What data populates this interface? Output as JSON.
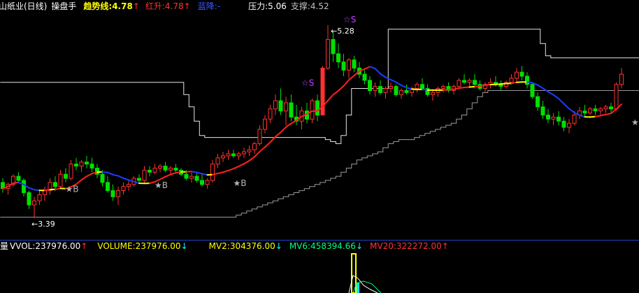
{
  "header": {
    "stock_name": "青山纸业(日线)",
    "indicator": "操盘手",
    "trend": "趋势线:4.78",
    "trend_arrow": "↑",
    "red_rise": "红升:4.78",
    "red_arrow": "↑",
    "blue_fall": "蓝降:-",
    "pressure": "压力:5.06",
    "support": "支撑:4.52"
  },
  "volume_header": {
    "title": "成交量",
    "vvol": "VVOL:237976.00",
    "vvol_arrow": "↑",
    "volume": "VOLUME:237976.00",
    "volume_arrow": "↓",
    "mv2": "MV2:304376.00",
    "mv2_arrow": "↓",
    "mv6": "MV6:458394.66",
    "mv6_arrow": "↓",
    "mv20": "MV20:322272.00",
    "mv20_arrow": "↑"
  },
  "colors": {
    "background": "#000000",
    "up_candle": "#ff3232",
    "down_candle": "#00e000",
    "trend_up": "#ff2020",
    "trend_down": "#1e3cff",
    "trend_flat": "#ffff00",
    "band": "#c8c8c8",
    "header_yellow": "#ffff00",
    "header_red": "#ff3232",
    "header_blue": "#3c5aff",
    "header_white": "#ffffff",
    "header_gray": "#c0c0c0",
    "mv2_green": "#00ff00",
    "mv6_green": "#00ff80",
    "signal_purple": "#c040ff",
    "signal_gray": "#b4b4b4",
    "divider": "#2040c0"
  },
  "chart_data": {
    "type": "candlestick",
    "annotations": [
      {
        "label": "5.28",
        "kind": "high"
      },
      {
        "label": "3.39",
        "kind": "low"
      },
      {
        "label": "B",
        "kind": "buy"
      },
      {
        "label": "B",
        "kind": "buy"
      },
      {
        "label": "B",
        "kind": "buy"
      },
      {
        "label": "S",
        "kind": "sell"
      },
      {
        "label": "S",
        "kind": "sell"
      }
    ],
    "ohlc": [
      [
        3.74,
        3.78,
        3.64,
        3.68
      ],
      [
        3.68,
        3.74,
        3.62,
        3.72
      ],
      [
        3.72,
        3.82,
        3.7,
        3.8
      ],
      [
        3.8,
        3.84,
        3.74,
        3.76
      ],
      [
        3.76,
        3.78,
        3.6,
        3.64
      ],
      [
        3.64,
        3.66,
        3.48,
        3.52
      ],
      [
        3.52,
        3.6,
        3.39,
        3.56
      ],
      [
        3.56,
        3.66,
        3.52,
        3.62
      ],
      [
        3.62,
        3.7,
        3.56,
        3.66
      ],
      [
        3.66,
        3.78,
        3.62,
        3.74
      ],
      [
        3.74,
        3.8,
        3.66,
        3.7
      ],
      [
        3.7,
        3.86,
        3.68,
        3.82
      ],
      [
        3.82,
        3.88,
        3.74,
        3.78
      ],
      [
        3.78,
        3.96,
        3.76,
        3.92
      ],
      [
        3.92,
        3.98,
        3.86,
        3.9
      ],
      [
        3.9,
        3.96,
        3.84,
        3.94
      ],
      [
        3.94,
        4.0,
        3.88,
        3.92
      ],
      [
        3.92,
        3.98,
        3.84,
        3.88
      ],
      [
        3.88,
        3.92,
        3.78,
        3.82
      ],
      [
        3.82,
        3.86,
        3.7,
        3.74
      ],
      [
        3.74,
        3.8,
        3.64,
        3.66
      ],
      [
        3.66,
        3.72,
        3.56,
        3.6
      ],
      [
        3.6,
        3.7,
        3.52,
        3.66
      ],
      [
        3.66,
        3.74,
        3.62,
        3.7
      ],
      [
        3.7,
        3.76,
        3.66,
        3.72
      ],
      [
        3.72,
        3.8,
        3.7,
        3.78
      ],
      [
        3.78,
        3.82,
        3.74,
        3.76
      ],
      [
        3.76,
        3.9,
        3.74,
        3.86
      ],
      [
        3.86,
        3.9,
        3.8,
        3.84
      ],
      [
        3.84,
        3.92,
        3.82,
        3.88
      ],
      [
        3.88,
        3.92,
        3.84,
        3.9
      ],
      [
        3.9,
        3.94,
        3.84,
        3.86
      ],
      [
        3.86,
        3.9,
        3.82,
        3.88
      ],
      [
        3.88,
        3.92,
        3.84,
        3.86
      ],
      [
        3.86,
        3.88,
        3.8,
        3.82
      ],
      [
        3.82,
        3.86,
        3.76,
        3.78
      ],
      [
        3.78,
        3.84,
        3.74,
        3.8
      ],
      [
        3.8,
        3.84,
        3.74,
        3.76
      ],
      [
        3.76,
        3.82,
        3.7,
        3.72
      ],
      [
        3.72,
        3.78,
        3.68,
        3.76
      ],
      [
        3.76,
        3.96,
        3.74,
        3.92
      ],
      [
        3.92,
        4.02,
        3.88,
        3.98
      ],
      [
        3.98,
        4.04,
        3.94,
        4.0
      ],
      [
        4.0,
        4.06,
        3.96,
        4.02
      ],
      [
        4.02,
        4.06,
        3.98,
        4.0
      ],
      [
        4.0,
        4.04,
        3.96,
        4.02
      ],
      [
        4.02,
        4.08,
        3.98,
        4.04
      ],
      [
        4.04,
        4.1,
        4.0,
        4.06
      ],
      [
        4.06,
        4.14,
        4.02,
        4.12
      ],
      [
        4.12,
        4.3,
        4.1,
        4.26
      ],
      [
        4.26,
        4.4,
        4.22,
        4.36
      ],
      [
        4.36,
        4.5,
        4.32,
        4.46
      ],
      [
        4.46,
        4.6,
        4.4,
        4.54
      ],
      [
        4.54,
        4.66,
        4.4,
        4.44
      ],
      [
        4.44,
        4.58,
        4.3,
        4.52
      ],
      [
        4.52,
        4.6,
        4.34,
        4.38
      ],
      [
        4.38,
        4.5,
        4.3,
        4.34
      ],
      [
        4.34,
        4.48,
        4.26,
        4.44
      ],
      [
        4.44,
        4.52,
        4.32,
        4.36
      ],
      [
        4.36,
        4.56,
        4.32,
        4.54
      ],
      [
        4.54,
        4.6,
        4.34,
        4.4
      ],
      [
        4.4,
        4.88,
        4.4,
        4.86
      ],
      [
        4.86,
        5.28,
        4.84,
        5.14
      ],
      [
        5.14,
        5.22,
        4.92,
        5.0
      ],
      [
        5.0,
        5.1,
        4.86,
        4.92
      ],
      [
        4.92,
        5.0,
        4.78,
        4.84
      ],
      [
        4.84,
        4.96,
        4.76,
        4.94
      ],
      [
        4.94,
        4.98,
        4.82,
        4.86
      ],
      [
        4.86,
        4.92,
        4.76,
        4.8
      ],
      [
        4.8,
        4.84,
        4.7,
        4.74
      ],
      [
        4.74,
        4.78,
        4.6,
        4.64
      ],
      [
        4.64,
        4.72,
        4.58,
        4.68
      ],
      [
        4.68,
        4.74,
        4.6,
        4.62
      ],
      [
        4.62,
        4.68,
        4.56,
        4.66
      ],
      [
        4.66,
        4.72,
        4.62,
        4.68
      ],
      [
        4.68,
        4.7,
        4.58,
        4.6
      ],
      [
        4.6,
        4.66,
        4.56,
        4.64
      ],
      [
        4.64,
        4.7,
        4.6,
        4.62
      ],
      [
        4.62,
        4.68,
        4.58,
        4.66
      ],
      [
        4.66,
        4.72,
        4.62,
        4.7
      ],
      [
        4.7,
        4.76,
        4.64,
        4.66
      ],
      [
        4.66,
        4.7,
        4.58,
        4.6
      ],
      [
        4.6,
        4.64,
        4.54,
        4.62
      ],
      [
        4.62,
        4.68,
        4.58,
        4.66
      ],
      [
        4.66,
        4.7,
        4.62,
        4.68
      ],
      [
        4.68,
        4.72,
        4.62,
        4.64
      ],
      [
        4.64,
        4.7,
        4.6,
        4.68
      ],
      [
        4.68,
        4.76,
        4.66,
        4.74
      ],
      [
        4.74,
        4.8,
        4.7,
        4.72
      ],
      [
        4.72,
        4.76,
        4.68,
        4.74
      ],
      [
        4.74,
        4.8,
        4.66,
        4.7
      ],
      [
        4.7,
        4.74,
        4.64,
        4.66
      ],
      [
        4.66,
        4.72,
        4.62,
        4.7
      ],
      [
        4.7,
        4.76,
        4.66,
        4.72
      ],
      [
        4.72,
        4.78,
        4.68,
        4.7
      ],
      [
        4.7,
        4.74,
        4.64,
        4.68
      ],
      [
        4.68,
        4.74,
        4.66,
        4.72
      ],
      [
        4.72,
        4.8,
        4.7,
        4.76
      ],
      [
        4.76,
        4.86,
        4.72,
        4.82
      ],
      [
        4.82,
        4.88,
        4.74,
        4.78
      ],
      [
        4.78,
        4.82,
        4.66,
        4.7
      ],
      [
        4.7,
        4.72,
        4.56,
        4.58
      ],
      [
        4.58,
        4.62,
        4.44,
        4.48
      ],
      [
        4.48,
        4.54,
        4.36,
        4.4
      ],
      [
        4.4,
        4.46,
        4.32,
        4.36
      ],
      [
        4.36,
        4.42,
        4.3,
        4.38
      ],
      [
        4.38,
        4.44,
        4.3,
        4.34
      ],
      [
        4.34,
        4.38,
        4.24,
        4.28
      ],
      [
        4.28,
        4.36,
        4.22,
        4.32
      ],
      [
        4.32,
        4.44,
        4.3,
        4.4
      ],
      [
        4.4,
        4.48,
        4.36,
        4.44
      ],
      [
        4.44,
        4.5,
        4.38,
        4.42
      ],
      [
        4.42,
        4.48,
        4.4,
        4.46
      ],
      [
        4.46,
        4.5,
        4.4,
        4.44
      ],
      [
        4.44,
        4.48,
        4.4,
        4.46
      ],
      [
        4.46,
        4.5,
        4.42,
        4.48
      ],
      [
        4.48,
        4.52,
        4.42,
        4.46
      ],
      [
        4.46,
        4.72,
        4.44,
        4.7
      ],
      [
        4.7,
        4.86,
        4.66,
        4.8
      ]
    ],
    "pressure_line": [
      4.72,
      4.72,
      4.72,
      4.72,
      4.72,
      4.72,
      4.72,
      4.72,
      4.72,
      4.72,
      4.72,
      4.72,
      4.72,
      4.72,
      4.72,
      4.72,
      4.72,
      4.72,
      4.72,
      4.72,
      4.72,
      4.72,
      4.72,
      4.72,
      4.72,
      4.72,
      4.72,
      4.72,
      4.72,
      4.72,
      4.72,
      4.72,
      4.72,
      4.72,
      4.72,
      4.6,
      4.48,
      4.34,
      4.2,
      4.18,
      4.18,
      4.18,
      4.18,
      4.18,
      4.18,
      4.18,
      4.18,
      4.18,
      4.18,
      4.18,
      4.18,
      4.18,
      4.18,
      4.18,
      4.18,
      4.18,
      4.18,
      4.18,
      4.18,
      4.18,
      4.18,
      4.18,
      4.16,
      4.14,
      4.12,
      4.2,
      4.4,
      4.66,
      4.66,
      4.66,
      4.66,
      4.66,
      4.66,
      4.66,
      5.24,
      5.24,
      5.24,
      5.24,
      5.24,
      5.24,
      5.24,
      5.24,
      5.24,
      5.24,
      5.24,
      5.24,
      5.24,
      5.24,
      5.24,
      5.24,
      5.24,
      5.24,
      5.24,
      5.24,
      5.24,
      5.24,
      5.24,
      5.24,
      5.24,
      5.24,
      5.24,
      5.24,
      5.24,
      5.1,
      4.98,
      4.96,
      4.96,
      4.96,
      4.96,
      4.96,
      4.96,
      4.96,
      4.96,
      4.96,
      4.96,
      4.96,
      4.96,
      4.96,
      4.96,
      4.96,
      4.96,
      4.96
    ],
    "support_line": [
      3.4,
      3.4,
      3.4,
      3.4,
      3.4,
      3.4,
      3.4,
      3.4,
      3.4,
      3.4,
      3.4,
      3.4,
      3.4,
      3.4,
      3.4,
      3.4,
      3.4,
      3.4,
      3.4,
      3.4,
      3.4,
      3.4,
      3.4,
      3.4,
      3.4,
      3.4,
      3.4,
      3.4,
      3.4,
      3.4,
      3.4,
      3.4,
      3.4,
      3.4,
      3.4,
      3.4,
      3.4,
      3.4,
      3.4,
      3.4,
      3.4,
      3.4,
      3.4,
      3.4,
      3.4,
      3.42,
      3.44,
      3.46,
      3.48,
      3.5,
      3.52,
      3.54,
      3.56,
      3.58,
      3.6,
      3.62,
      3.64,
      3.66,
      3.68,
      3.7,
      3.72,
      3.74,
      3.76,
      3.78,
      3.8,
      3.84,
      3.88,
      3.92,
      3.96,
      3.98,
      4.0,
      4.02,
      4.04,
      4.08,
      4.12,
      4.14,
      4.16,
      4.16,
      4.16,
      4.18,
      4.2,
      4.22,
      4.24,
      4.26,
      4.28,
      4.3,
      4.32,
      4.36,
      4.4,
      4.46,
      4.52,
      4.58,
      4.62,
      4.64,
      4.64,
      4.64,
      4.64,
      4.64,
      4.64,
      4.64,
      4.64,
      4.64,
      4.64,
      4.64,
      4.64,
      4.64,
      4.64,
      4.64,
      4.64,
      4.64,
      4.64,
      4.64,
      4.64,
      4.64,
      4.64,
      4.64,
      4.64,
      4.64,
      4.64,
      4.64,
      4.64,
      4.64,
      4.64
    ],
    "volume_visible": [
      {
        "index": 119,
        "value": 237976
      }
    ]
  }
}
